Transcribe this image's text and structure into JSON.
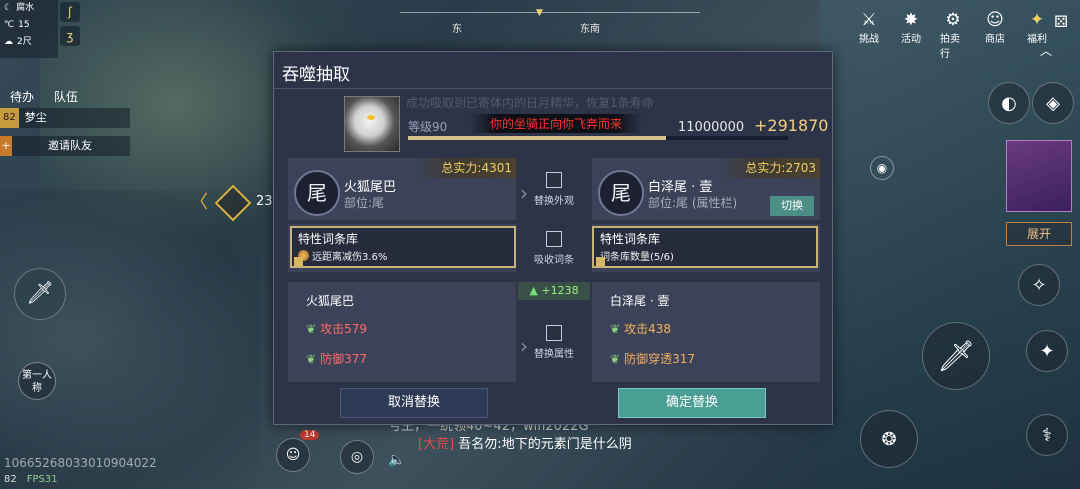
{
  "hud": {
    "weather": [
      {
        "icon": "moon-icon",
        "label": "腐水"
      },
      {
        "icon": "thermometer-icon",
        "label": "15"
      },
      {
        "icon": "wind-icon",
        "label": "2尺"
      }
    ],
    "compass": {
      "left": "东",
      "right": "东南"
    },
    "top_menu": [
      {
        "icon": "battle-icon",
        "label": "挑战"
      },
      {
        "icon": "activity-icon",
        "label": "活动"
      },
      {
        "icon": "auction-icon",
        "label": "拍卖行"
      },
      {
        "icon": "shop-icon",
        "label": "商店"
      },
      {
        "icon": "welfare-icon",
        "label": "福利"
      }
    ],
    "task_tabs": [
      "待办",
      "队伍"
    ],
    "tasks": [
      {
        "level": "82",
        "name": "梦尘"
      },
      {
        "level": "+",
        "name": "邀请队友"
      }
    ],
    "quest_counter": "23",
    "view_button": "第一人称",
    "bottom_id": "10665268033010904022",
    "bottom_level": "82",
    "fps": "FPS31",
    "chat": {
      "line1": "亏王，一统领40~42，wifi2022G",
      "tag": "[大荒]",
      "sender": "吾名勿:",
      "message": "地下的元素门是什么阴"
    },
    "chat_badge": "14",
    "expand_label": "展开"
  },
  "dialog": {
    "title": "吞噬抽取",
    "ghost_message": "成功吸取到已寄体内的日月精华，恢复1条寿命",
    "level_label": "等级90",
    "exp_progress": 0.68,
    "float_message": "你的坐骑正向你飞奔而来",
    "exp_value": "11000000",
    "exp_gain": "+291870",
    "left": {
      "icon_char": "尾",
      "name": "火狐尾巴",
      "part": "部位:尾",
      "power": "总实力:4301",
      "trait_title": "特性词条库",
      "trait_line": "远距离减伤3.6%",
      "attr_title": "火狐尾巴",
      "attrs": [
        "攻击579",
        "防御377"
      ]
    },
    "right": {
      "icon_char": "尾",
      "name": "白泽尾 · 壹",
      "part": "部位:尾 (属性栏)",
      "power": "总实力:2703",
      "switch_label": "切换",
      "trait_title": "特性词条库",
      "trait_line": "词条库数量(5/6)",
      "attr_title": "白泽尾 · 壹",
      "attrs": [
        "攻击438",
        "防御穿透317"
      ]
    },
    "middle": {
      "replace_look": "替换外观",
      "absorb_trait": "吸收词条",
      "replace_attr": "替换属性",
      "delta": "+1238"
    },
    "cancel_label": "取消替换",
    "confirm_label": "确定替换"
  }
}
